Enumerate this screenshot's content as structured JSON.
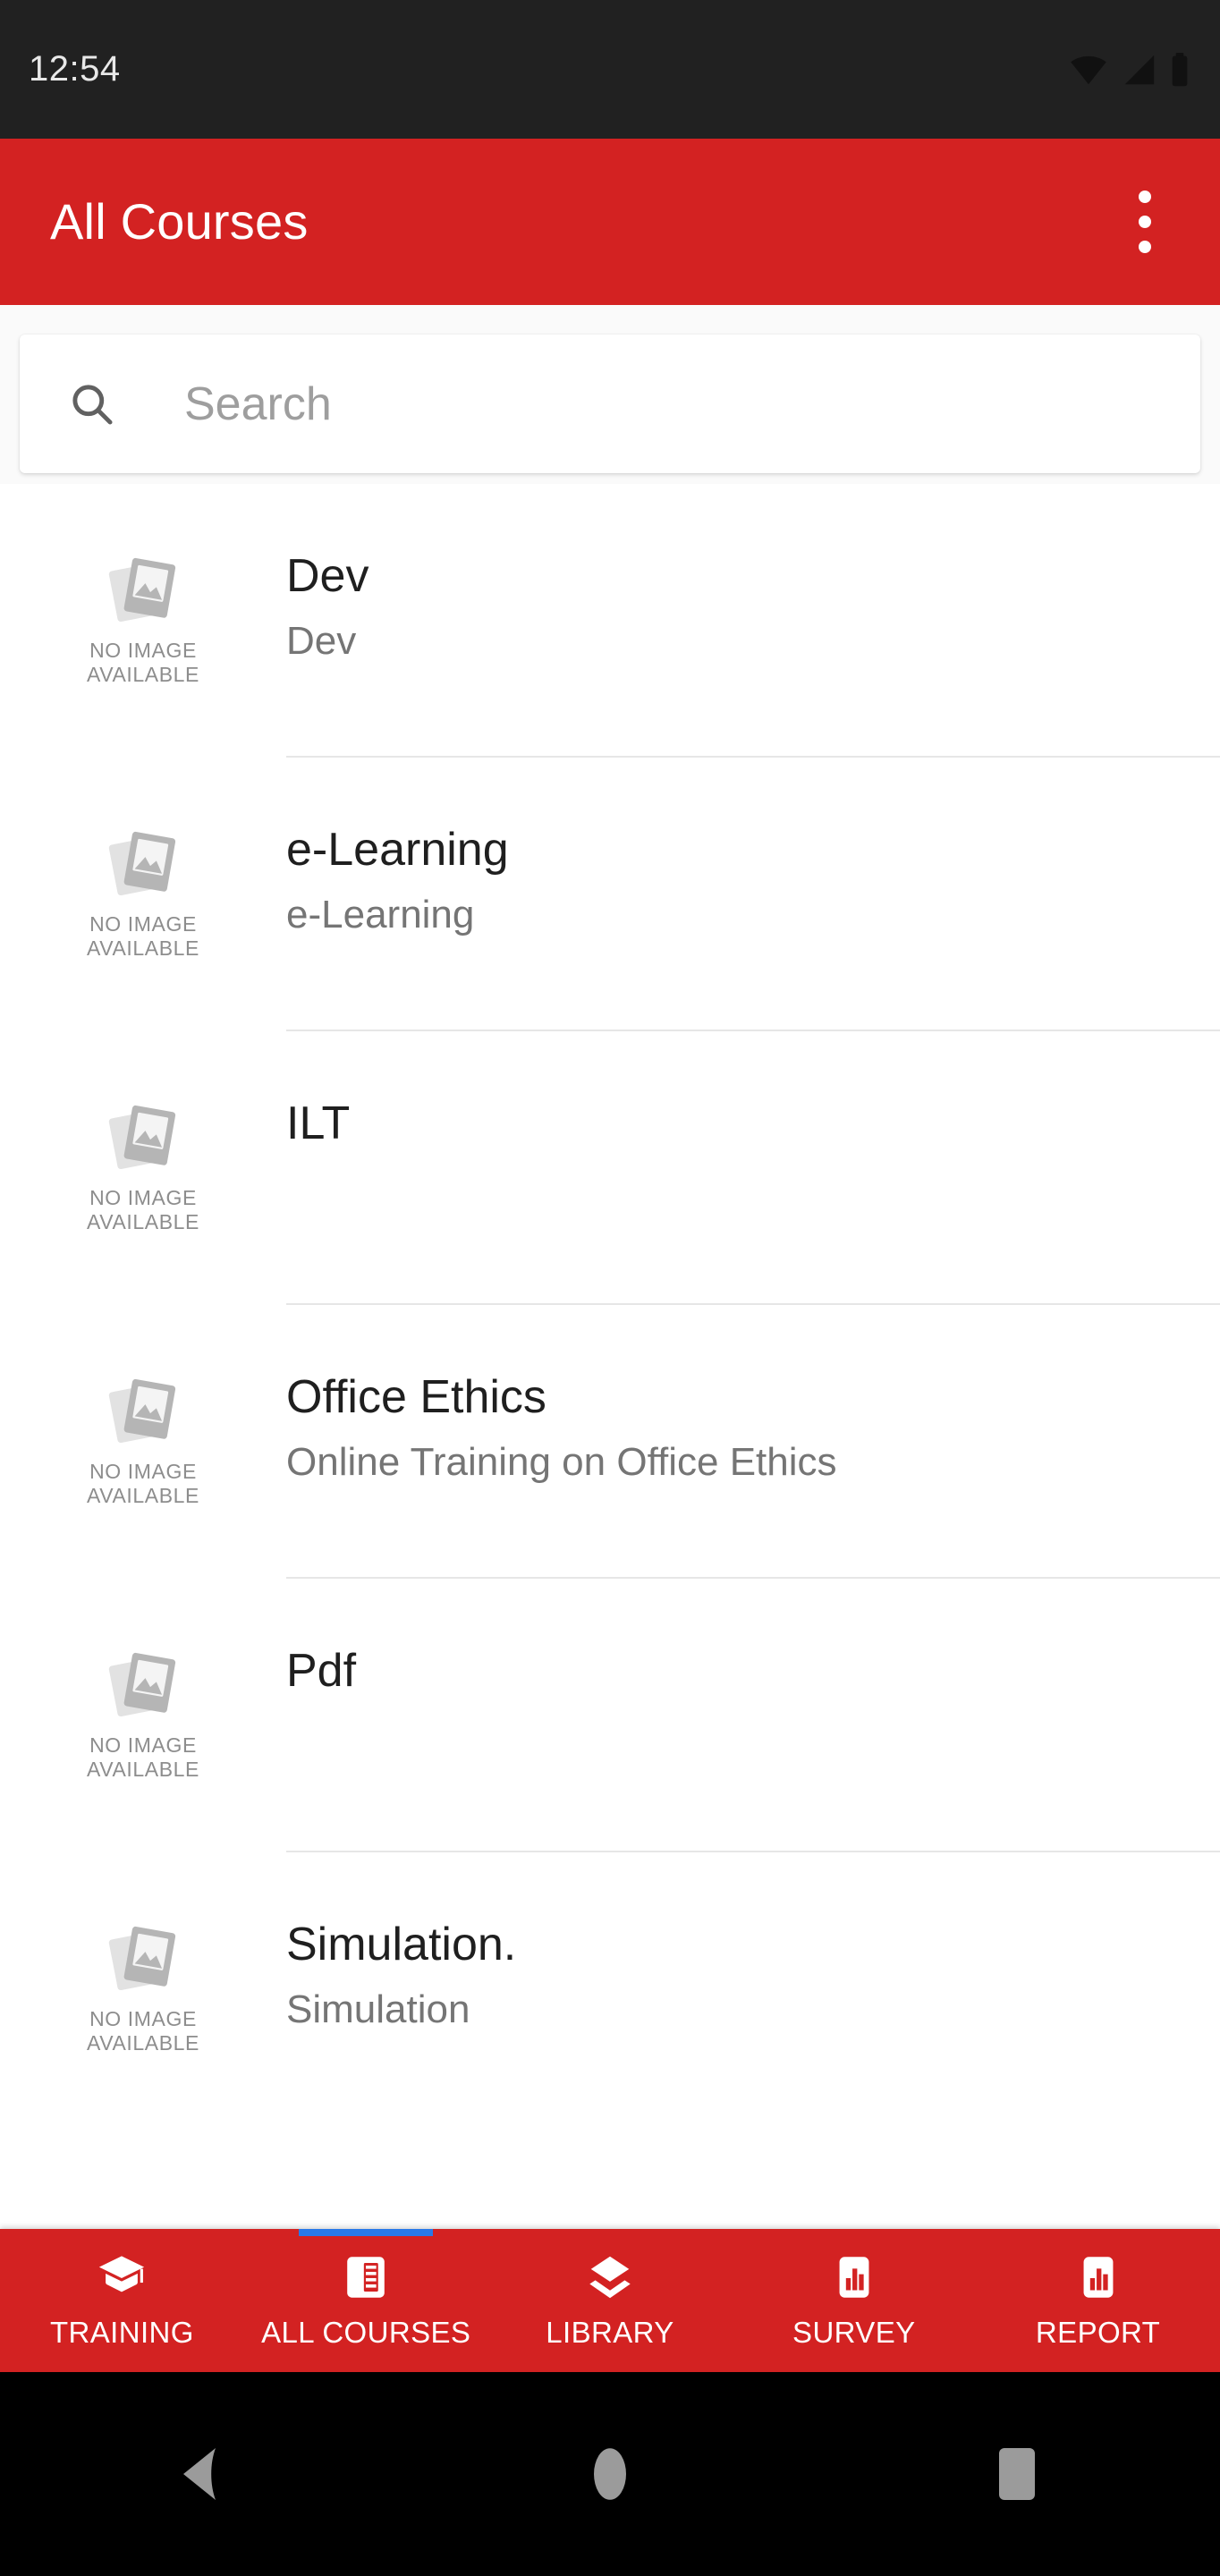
{
  "status_bar": {
    "time": "12:54",
    "icons": [
      "wifi-icon",
      "cellular-signal-icon",
      "battery-icon"
    ]
  },
  "app_bar": {
    "title": "All Courses",
    "overflow_menu_name": "more-options-icon",
    "background_color": "#D32222"
  },
  "search": {
    "placeholder": "Search",
    "value": "",
    "icon": "search-icon"
  },
  "list": {
    "placeholder_label_line1": "NO IMAGE",
    "placeholder_label_line2": "AVAILABLE",
    "items": [
      {
        "title": "Dev",
        "subtitle": "Dev"
      },
      {
        "title": "e-Learning",
        "subtitle": "e-Learning"
      },
      {
        "title": "ILT",
        "subtitle": ""
      },
      {
        "title": "Office Ethics",
        "subtitle": "Online Training on Office Ethics"
      },
      {
        "title": "Pdf",
        "subtitle": ""
      },
      {
        "title": "Simulation.",
        "subtitle": "Simulation"
      }
    ]
  },
  "bottom_nav": {
    "active_index": 1,
    "active_indicator_color": "#2979e8",
    "background_color": "#D32222",
    "items": [
      {
        "label": "TRAINING",
        "icon": "graduation-cap-icon"
      },
      {
        "label": "ALL COURSES",
        "icon": "book-pages-icon"
      },
      {
        "label": "LIBRARY",
        "icon": "layers-icon"
      },
      {
        "label": "SURVEY",
        "icon": "bar-chart-icon"
      },
      {
        "label": "REPORT",
        "icon": "bar-chart-icon"
      }
    ]
  },
  "android_nav": {
    "buttons": [
      {
        "name": "back-button",
        "icon": "triangle-left-icon"
      },
      {
        "name": "home-button",
        "icon": "circle-icon"
      },
      {
        "name": "recents-button",
        "icon": "square-icon"
      }
    ]
  }
}
